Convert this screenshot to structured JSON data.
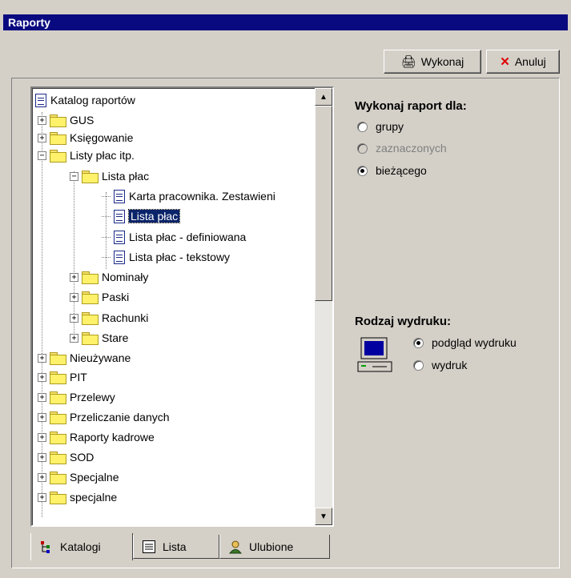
{
  "window": {
    "title": "Raporty"
  },
  "toolbar": {
    "run_label": "Wykonaj",
    "cancel_label": "Anuluj"
  },
  "tree": {
    "items": [
      {
        "label": "Katalog raportów",
        "type": "root"
      },
      {
        "label": "GUS",
        "type": "folder"
      },
      {
        "label": "Księgowanie",
        "type": "folder"
      },
      {
        "label": "Listy płac itp.",
        "type": "folder"
      },
      {
        "label": "Lista płac",
        "type": "folder"
      },
      {
        "label": "Karta pracownika. Zestawieni",
        "type": "report"
      },
      {
        "label": "Lista płac",
        "type": "report",
        "selected": true
      },
      {
        "label": "Lista płac - definiowana",
        "type": "report"
      },
      {
        "label": "Lista płac - tekstowy",
        "type": "report"
      },
      {
        "label": "Nominały",
        "type": "folder"
      },
      {
        "label": "Paski",
        "type": "folder"
      },
      {
        "label": "Rachunki",
        "type": "folder"
      },
      {
        "label": "Stare",
        "type": "folder"
      },
      {
        "label": "Nieużywane",
        "type": "folder"
      },
      {
        "label": "PIT",
        "type": "folder"
      },
      {
        "label": "Przelewy",
        "type": "folder"
      },
      {
        "label": "Przeliczanie danych",
        "type": "folder"
      },
      {
        "label": "Raporty kadrowe",
        "type": "folder"
      },
      {
        "label": "SOD",
        "type": "folder"
      },
      {
        "label": "Specjalne",
        "type": "folder"
      },
      {
        "label": "specjalne",
        "type": "folder"
      }
    ]
  },
  "tabs": [
    {
      "label": "Katalogi",
      "active": true,
      "icon": "tree-icon"
    },
    {
      "label": "Lista",
      "active": false,
      "icon": "list-icon"
    },
    {
      "label": "Ulubione",
      "active": false,
      "icon": "person-icon"
    }
  ],
  "run_for": {
    "title": "Wykonaj raport dla:",
    "options": [
      {
        "label": "grupy",
        "checked": false,
        "disabled": false
      },
      {
        "label": "zaznaczonych",
        "checked": false,
        "disabled": true
      },
      {
        "label": "bieżącego",
        "checked": true,
        "disabled": false
      }
    ]
  },
  "print_type": {
    "title": "Rodzaj wydruku:",
    "options": [
      {
        "label": "podgląd wydruku",
        "checked": true
      },
      {
        "label": "wydruk",
        "checked": false
      }
    ]
  },
  "colors": {
    "title_bar": "#0a0a80",
    "selection": "#0a246a",
    "cancel_icon": "#e00000",
    "folder": "#fff26a"
  }
}
